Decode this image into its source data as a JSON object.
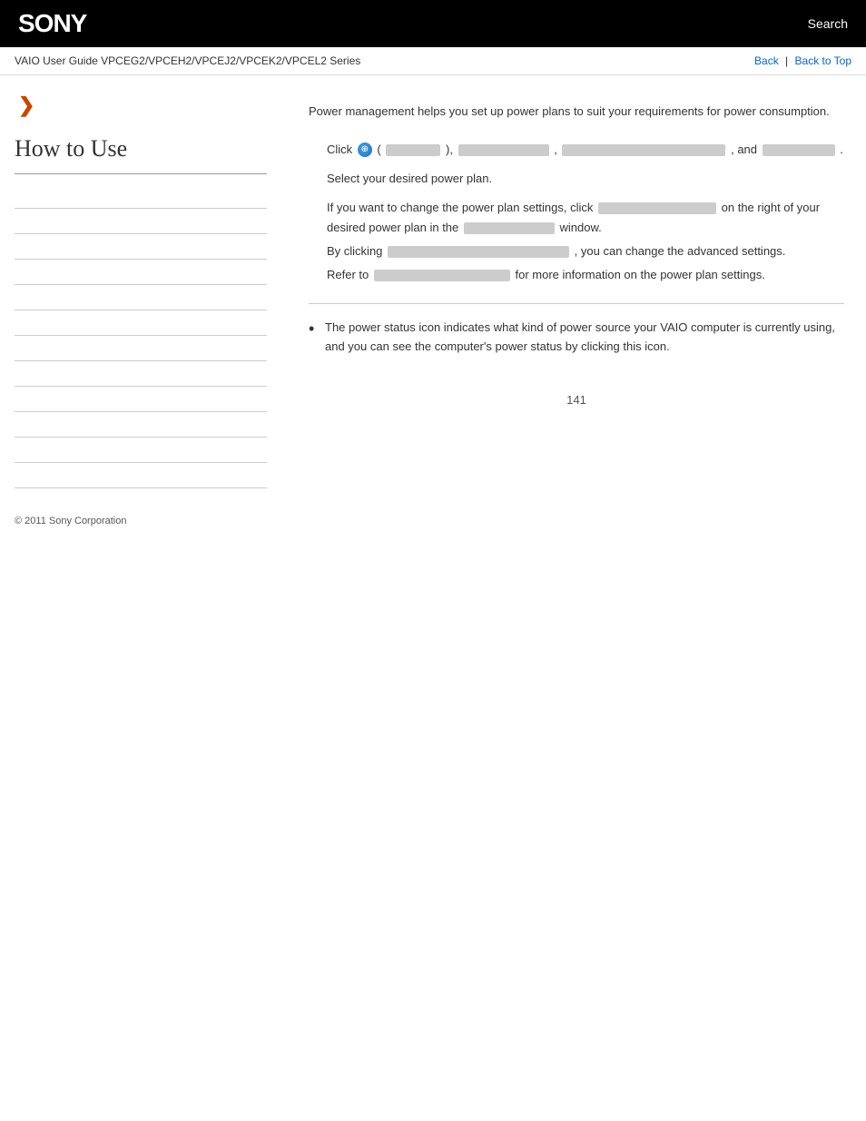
{
  "header": {
    "logo": "SONY",
    "search_label": "Search"
  },
  "navbar": {
    "guide_title": "VAIO User Guide VPCEG2/VPCEH2/VPCEJ2/VPCEK2/VPCEL2 Series",
    "back_label": "Back",
    "separator": "|",
    "back_to_top_label": "Back to Top"
  },
  "sidebar": {
    "arrow": "❯",
    "section_title": "How to Use",
    "items": [
      {
        "label": ""
      },
      {
        "label": ""
      },
      {
        "label": ""
      },
      {
        "label": ""
      },
      {
        "label": ""
      },
      {
        "label": ""
      },
      {
        "label": ""
      },
      {
        "label": ""
      },
      {
        "label": ""
      },
      {
        "label": ""
      },
      {
        "label": ""
      },
      {
        "label": ""
      }
    ],
    "copyright": "© 2011 Sony Corporation"
  },
  "content": {
    "intro": "Power management helps you set up power plans to suit your requirements for power consumption.",
    "step1_prefix": "Click",
    "step1_suffix_a": "(",
    "step1_suffix_b": "),",
    "step1_suffix_c": ",",
    "step1_suffix_d": ", and",
    "step1_suffix_e": ".",
    "step2": "Select your desired power plan.",
    "step3_prefix": "If you want to change the power plan settings, click",
    "step3_suffix": "on the right of your desired power plan in the",
    "step3_suffix2": "window.",
    "step4_prefix": "By clicking",
    "step4_suffix": ", you can change the advanced settings.",
    "step5_prefix": "Refer to",
    "step5_suffix": "for more information on the power plan settings.",
    "bullet1": "The power status icon indicates what kind of power source your VAIO computer is currently using, and you can see the computer's power status by clicking this icon."
  },
  "footer": {
    "page_number": "141"
  }
}
